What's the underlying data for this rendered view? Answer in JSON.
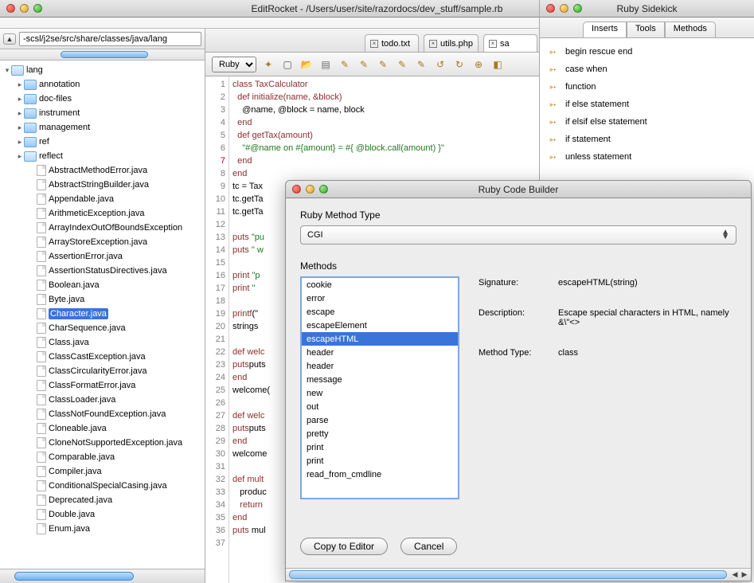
{
  "window": {
    "title": "EditRocket - /Users/user/site/razordocs/dev_stuff/sample.rb"
  },
  "sidebar": {
    "path": "-scsl/j2se/src/share/classes/java/lang",
    "root_label": "lang",
    "folders": [
      {
        "label": "annotation",
        "open": false
      },
      {
        "label": "doc-files",
        "open": false
      },
      {
        "label": "instrument",
        "open": false
      },
      {
        "label": "management",
        "open": false
      },
      {
        "label": "ref",
        "open": false
      },
      {
        "label": "reflect",
        "open": true
      }
    ],
    "files": [
      "AbstractMethodError.java",
      "AbstractStringBuilder.java",
      "Appendable.java",
      "ArithmeticException.java",
      "ArrayIndexOutOfBoundsException",
      "ArrayStoreException.java",
      "AssertionError.java",
      "AssertionStatusDirectives.java",
      "Boolean.java",
      "Byte.java",
      "Character.java",
      "CharSequence.java",
      "Class.java",
      "ClassCastException.java",
      "ClassCircularityError.java",
      "ClassFormatError.java",
      "ClassLoader.java",
      "ClassNotFoundException.java",
      "Cloneable.java",
      "CloneNotSupportedException.java",
      "Comparable.java",
      "Compiler.java",
      "ConditionalSpecialCasing.java",
      "Deprecated.java",
      "Double.java",
      "Enum.java"
    ],
    "selected_file": "Character.java"
  },
  "tabs": [
    {
      "label": "todo.txt",
      "active": false
    },
    {
      "label": "utils.php",
      "active": false
    },
    {
      "label": "sa",
      "active": true
    }
  ],
  "toolbar": {
    "language": "Ruby"
  },
  "code": {
    "lines": [
      {
        "n": 1,
        "t": "class TaxCalculator",
        "k": true
      },
      {
        "n": 2,
        "t": "  def initialize(name, &block)",
        "k": true
      },
      {
        "n": 3,
        "t": "    @name, @block = name, block"
      },
      {
        "n": 4,
        "t": "  end",
        "k": true
      },
      {
        "n": 5,
        "t": "  def getTax(amount)",
        "k": true
      },
      {
        "n": 6,
        "t": "    \"#@name on #{amount} = #{ @block.call(amount) }\"",
        "s": true
      },
      {
        "n": 7,
        "t": "  end",
        "k": true,
        "err": true
      },
      {
        "n": 8,
        "t": "end",
        "k": true
      },
      {
        "n": 9,
        "t": "tc = Tax"
      },
      {
        "n": 10,
        "t": "tc.getTa"
      },
      {
        "n": 11,
        "t": "tc.getTa"
      },
      {
        "n": 12,
        "t": ""
      },
      {
        "n": 13,
        "t": "puts \"pu",
        "pk": "puts",
        "s": true
      },
      {
        "n": 14,
        "t": "puts \" w",
        "pk": "puts",
        "s": true
      },
      {
        "n": 15,
        "t": ""
      },
      {
        "n": 16,
        "t": "print \"p",
        "pk": "print",
        "s": true
      },
      {
        "n": 17,
        "t": "print \" ",
        "pk": "print",
        "s": true
      },
      {
        "n": 18,
        "t": ""
      },
      {
        "n": 19,
        "t": "printf(\"",
        "pk": "printf"
      },
      {
        "n": 20,
        "t": "strings "
      },
      {
        "n": 21,
        "t": ""
      },
      {
        "n": 22,
        "t": "def welc",
        "k": true
      },
      {
        "n": 23,
        "t": "    puts",
        "pk": "puts"
      },
      {
        "n": 24,
        "t": "end",
        "k": true
      },
      {
        "n": 25,
        "t": "welcome("
      },
      {
        "n": 26,
        "t": ""
      },
      {
        "n": 27,
        "t": "def welc",
        "k": true
      },
      {
        "n": 28,
        "t": "    puts",
        "pk": "puts"
      },
      {
        "n": 29,
        "t": "end",
        "k": true
      },
      {
        "n": 30,
        "t": "welcome "
      },
      {
        "n": 31,
        "t": ""
      },
      {
        "n": 32,
        "t": "def mult",
        "k": true
      },
      {
        "n": 33,
        "t": "   produc"
      },
      {
        "n": 34,
        "t": "   return",
        "k": true
      },
      {
        "n": 35,
        "t": "end",
        "k": true
      },
      {
        "n": 36,
        "t": "puts mul",
        "pk": "puts"
      },
      {
        "n": 37,
        "t": ""
      }
    ]
  },
  "sidekick": {
    "title": "Ruby Sidekick",
    "tabs": [
      "Inserts",
      "Tools",
      "Methods"
    ],
    "active_tab": "Inserts",
    "items": [
      "begin rescue end",
      "case when",
      "function",
      "if else statement",
      "if elsif else statement",
      "if statement",
      "unless statement"
    ]
  },
  "dialog": {
    "title": "Ruby Code Builder",
    "type_label": "Ruby Method Type",
    "type_value": "CGI",
    "methods_label": "Methods",
    "methods": [
      "cookie",
      "error",
      "escape",
      "escapeElement",
      "escapeHTML",
      "header",
      "header",
      "message",
      "new",
      "out",
      "parse",
      "pretty",
      "print",
      "print",
      "read_from_cmdline"
    ],
    "selected_method": "escapeHTML",
    "sig_label": "Signature:",
    "sig_value": "escapeHTML(string)",
    "desc_label": "Description:",
    "desc_value": "Escape special characters in HTML, namely &\\\"<>",
    "mtype_label": "Method Type:",
    "mtype_value": "class",
    "copy_btn": "Copy to Editor",
    "cancel_btn": "Cancel"
  }
}
